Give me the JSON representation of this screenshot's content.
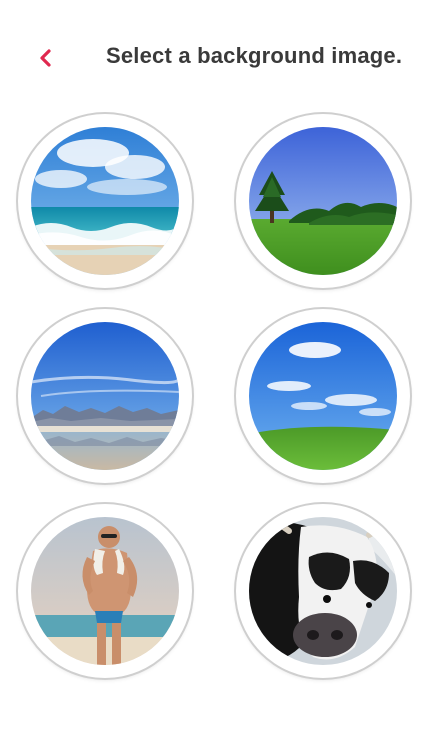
{
  "header": {
    "title": "Select a background image.",
    "accent_color": "#e0284f"
  },
  "backgrounds": [
    {
      "icon": "beach-waves-image"
    },
    {
      "icon": "tree-on-meadow-image"
    },
    {
      "icon": "mountain-lake-image"
    },
    {
      "icon": "blue-sky-green-hill-image"
    },
    {
      "icon": "man-on-beach-image"
    },
    {
      "icon": "cow-face-image"
    }
  ]
}
